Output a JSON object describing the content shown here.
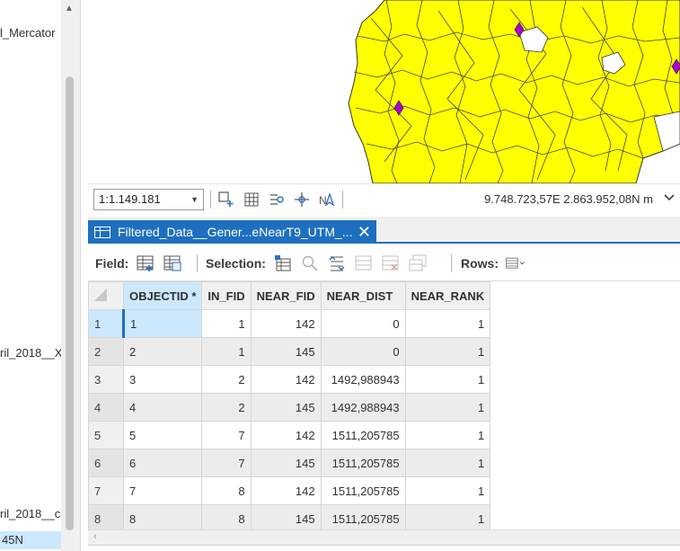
{
  "contents_pane": {
    "items": [
      {
        "label": "l_Mercator",
        "selected": false
      },
      {
        "label": "ril_2018__X",
        "selected": false
      },
      {
        "label": "ril_2018__c",
        "selected": false
      },
      {
        "label": "45N",
        "selected": true
      }
    ]
  },
  "map": {
    "polygon_fill": "#ffff00",
    "marker_color": "#b000d8"
  },
  "status_bar": {
    "scale": "1:1.149.181",
    "coordinates": "9.748.723,57E 2.863.952,08N m"
  },
  "table_tab": {
    "title": "Filtered_Data__Gener...eNearT9_UTM_...",
    "close_glyph": "✕"
  },
  "toolbar": {
    "field_label": "Field:",
    "selection_label": "Selection:",
    "rows_label": "Rows:"
  },
  "table": {
    "columns": [
      "OBJECTID *",
      "IN_FID",
      "NEAR_FID",
      "NEAR_DIST",
      "NEAR_RANK"
    ],
    "rows": [
      {
        "row": "1",
        "objectid": "1",
        "in_fid": "1",
        "near_fid": "142",
        "near_dist": "0",
        "near_rank": "1"
      },
      {
        "row": "2",
        "objectid": "2",
        "in_fid": "1",
        "near_fid": "145",
        "near_dist": "0",
        "near_rank": "1"
      },
      {
        "row": "3",
        "objectid": "3",
        "in_fid": "2",
        "near_fid": "142",
        "near_dist": "1492,988943",
        "near_rank": "1"
      },
      {
        "row": "4",
        "objectid": "4",
        "in_fid": "2",
        "near_fid": "145",
        "near_dist": "1492,988943",
        "near_rank": "1"
      },
      {
        "row": "5",
        "objectid": "5",
        "in_fid": "7",
        "near_fid": "142",
        "near_dist": "1511,205785",
        "near_rank": "1"
      },
      {
        "row": "6",
        "objectid": "6",
        "in_fid": "7",
        "near_fid": "145",
        "near_dist": "1511,205785",
        "near_rank": "1"
      },
      {
        "row": "7",
        "objectid": "7",
        "in_fid": "8",
        "near_fid": "142",
        "near_dist": "1511,205785",
        "near_rank": "1"
      },
      {
        "row": "8",
        "objectid": "8",
        "in_fid": "8",
        "near_fid": "145",
        "near_dist": "1511,205785",
        "near_rank": "1"
      }
    ]
  }
}
